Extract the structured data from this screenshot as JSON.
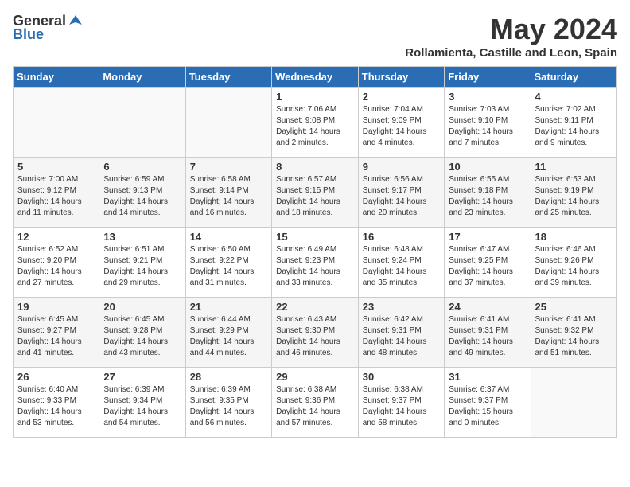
{
  "header": {
    "logo_general": "General",
    "logo_blue": "Blue",
    "title": "May 2024",
    "subtitle": "Rollamienta, Castille and Leon, Spain"
  },
  "days_of_week": [
    "Sunday",
    "Monday",
    "Tuesday",
    "Wednesday",
    "Thursday",
    "Friday",
    "Saturday"
  ],
  "weeks": [
    [
      {
        "day": "",
        "info": ""
      },
      {
        "day": "",
        "info": ""
      },
      {
        "day": "",
        "info": ""
      },
      {
        "day": "1",
        "info": "Sunrise: 7:06 AM\nSunset: 9:08 PM\nDaylight: 14 hours\nand 2 minutes."
      },
      {
        "day": "2",
        "info": "Sunrise: 7:04 AM\nSunset: 9:09 PM\nDaylight: 14 hours\nand 4 minutes."
      },
      {
        "day": "3",
        "info": "Sunrise: 7:03 AM\nSunset: 9:10 PM\nDaylight: 14 hours\nand 7 minutes."
      },
      {
        "day": "4",
        "info": "Sunrise: 7:02 AM\nSunset: 9:11 PM\nDaylight: 14 hours\nand 9 minutes."
      }
    ],
    [
      {
        "day": "5",
        "info": "Sunrise: 7:00 AM\nSunset: 9:12 PM\nDaylight: 14 hours\nand 11 minutes."
      },
      {
        "day": "6",
        "info": "Sunrise: 6:59 AM\nSunset: 9:13 PM\nDaylight: 14 hours\nand 14 minutes."
      },
      {
        "day": "7",
        "info": "Sunrise: 6:58 AM\nSunset: 9:14 PM\nDaylight: 14 hours\nand 16 minutes."
      },
      {
        "day": "8",
        "info": "Sunrise: 6:57 AM\nSunset: 9:15 PM\nDaylight: 14 hours\nand 18 minutes."
      },
      {
        "day": "9",
        "info": "Sunrise: 6:56 AM\nSunset: 9:17 PM\nDaylight: 14 hours\nand 20 minutes."
      },
      {
        "day": "10",
        "info": "Sunrise: 6:55 AM\nSunset: 9:18 PM\nDaylight: 14 hours\nand 23 minutes."
      },
      {
        "day": "11",
        "info": "Sunrise: 6:53 AM\nSunset: 9:19 PM\nDaylight: 14 hours\nand 25 minutes."
      }
    ],
    [
      {
        "day": "12",
        "info": "Sunrise: 6:52 AM\nSunset: 9:20 PM\nDaylight: 14 hours\nand 27 minutes."
      },
      {
        "day": "13",
        "info": "Sunrise: 6:51 AM\nSunset: 9:21 PM\nDaylight: 14 hours\nand 29 minutes."
      },
      {
        "day": "14",
        "info": "Sunrise: 6:50 AM\nSunset: 9:22 PM\nDaylight: 14 hours\nand 31 minutes."
      },
      {
        "day": "15",
        "info": "Sunrise: 6:49 AM\nSunset: 9:23 PM\nDaylight: 14 hours\nand 33 minutes."
      },
      {
        "day": "16",
        "info": "Sunrise: 6:48 AM\nSunset: 9:24 PM\nDaylight: 14 hours\nand 35 minutes."
      },
      {
        "day": "17",
        "info": "Sunrise: 6:47 AM\nSunset: 9:25 PM\nDaylight: 14 hours\nand 37 minutes."
      },
      {
        "day": "18",
        "info": "Sunrise: 6:46 AM\nSunset: 9:26 PM\nDaylight: 14 hours\nand 39 minutes."
      }
    ],
    [
      {
        "day": "19",
        "info": "Sunrise: 6:45 AM\nSunset: 9:27 PM\nDaylight: 14 hours\nand 41 minutes."
      },
      {
        "day": "20",
        "info": "Sunrise: 6:45 AM\nSunset: 9:28 PM\nDaylight: 14 hours\nand 43 minutes."
      },
      {
        "day": "21",
        "info": "Sunrise: 6:44 AM\nSunset: 9:29 PM\nDaylight: 14 hours\nand 44 minutes."
      },
      {
        "day": "22",
        "info": "Sunrise: 6:43 AM\nSunset: 9:30 PM\nDaylight: 14 hours\nand 46 minutes."
      },
      {
        "day": "23",
        "info": "Sunrise: 6:42 AM\nSunset: 9:31 PM\nDaylight: 14 hours\nand 48 minutes."
      },
      {
        "day": "24",
        "info": "Sunrise: 6:41 AM\nSunset: 9:31 PM\nDaylight: 14 hours\nand 49 minutes."
      },
      {
        "day": "25",
        "info": "Sunrise: 6:41 AM\nSunset: 9:32 PM\nDaylight: 14 hours\nand 51 minutes."
      }
    ],
    [
      {
        "day": "26",
        "info": "Sunrise: 6:40 AM\nSunset: 9:33 PM\nDaylight: 14 hours\nand 53 minutes."
      },
      {
        "day": "27",
        "info": "Sunrise: 6:39 AM\nSunset: 9:34 PM\nDaylight: 14 hours\nand 54 minutes."
      },
      {
        "day": "28",
        "info": "Sunrise: 6:39 AM\nSunset: 9:35 PM\nDaylight: 14 hours\nand 56 minutes."
      },
      {
        "day": "29",
        "info": "Sunrise: 6:38 AM\nSunset: 9:36 PM\nDaylight: 14 hours\nand 57 minutes."
      },
      {
        "day": "30",
        "info": "Sunrise: 6:38 AM\nSunset: 9:37 PM\nDaylight: 14 hours\nand 58 minutes."
      },
      {
        "day": "31",
        "info": "Sunrise: 6:37 AM\nSunset: 9:37 PM\nDaylight: 15 hours\nand 0 minutes."
      },
      {
        "day": "",
        "info": ""
      }
    ]
  ]
}
